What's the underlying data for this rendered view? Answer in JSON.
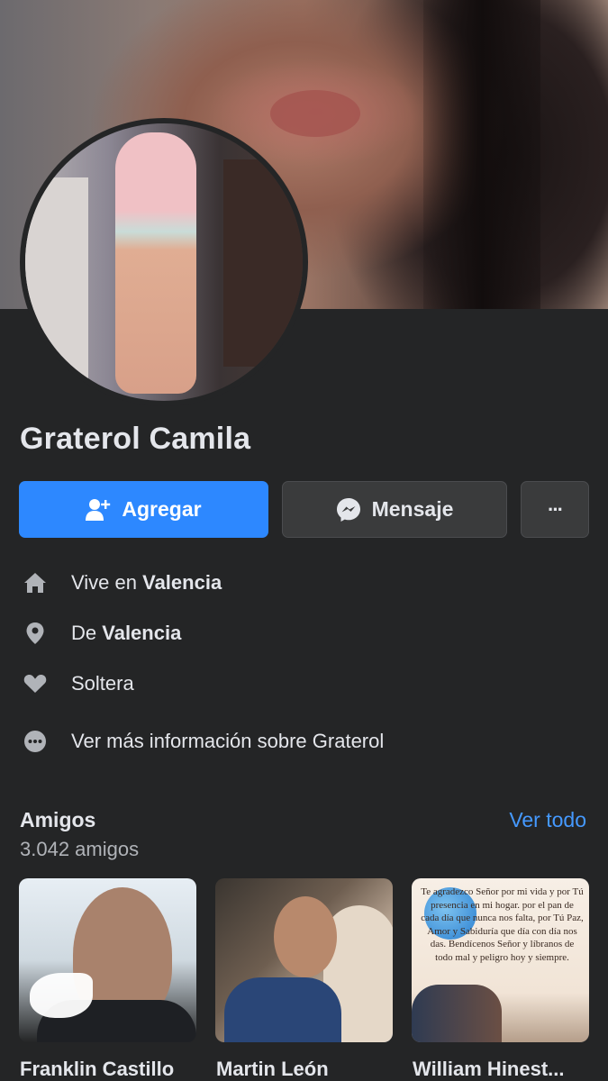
{
  "profile": {
    "name": "Graterol Camila"
  },
  "actions": {
    "add_label": "Agregar",
    "message_label": "Mensaje",
    "more_label": "···"
  },
  "info": {
    "lives_prefix": "Vive en ",
    "lives_city": "Valencia",
    "from_prefix": "De ",
    "from_city": "Valencia",
    "relationship": "Soltera",
    "more_info": "Ver más información sobre Graterol"
  },
  "icons": {
    "home": "home-icon",
    "location": "location-pin-icon",
    "relationship": "heart-icon",
    "more": "more-dots-icon",
    "add_friend": "add-friend-icon",
    "messenger": "messenger-icon"
  },
  "friends": {
    "title": "Amigos",
    "see_all": "Ver todo",
    "count": "3.042 amigos",
    "items": [
      {
        "name": "Franklin Castillo"
      },
      {
        "name": "Martin León"
      },
      {
        "name": "William Hinest..."
      }
    ],
    "card3_text": "Te agradezco Señor por mi vida y por Tú presencia en mi hogar. por el pan de cada día que nunca nos falta, por Tú Paz, Amor y Sabiduría que día con día nos das. Bendícenos Señor y líbranos de todo mal y peligro hoy y siempre."
  },
  "colors": {
    "background": "#242526",
    "primary_button": "#2d88ff",
    "secondary_button": "#3a3b3c",
    "link": "#4599ff",
    "text": "#e4e6eb",
    "muted_text": "#b0b3b8"
  }
}
